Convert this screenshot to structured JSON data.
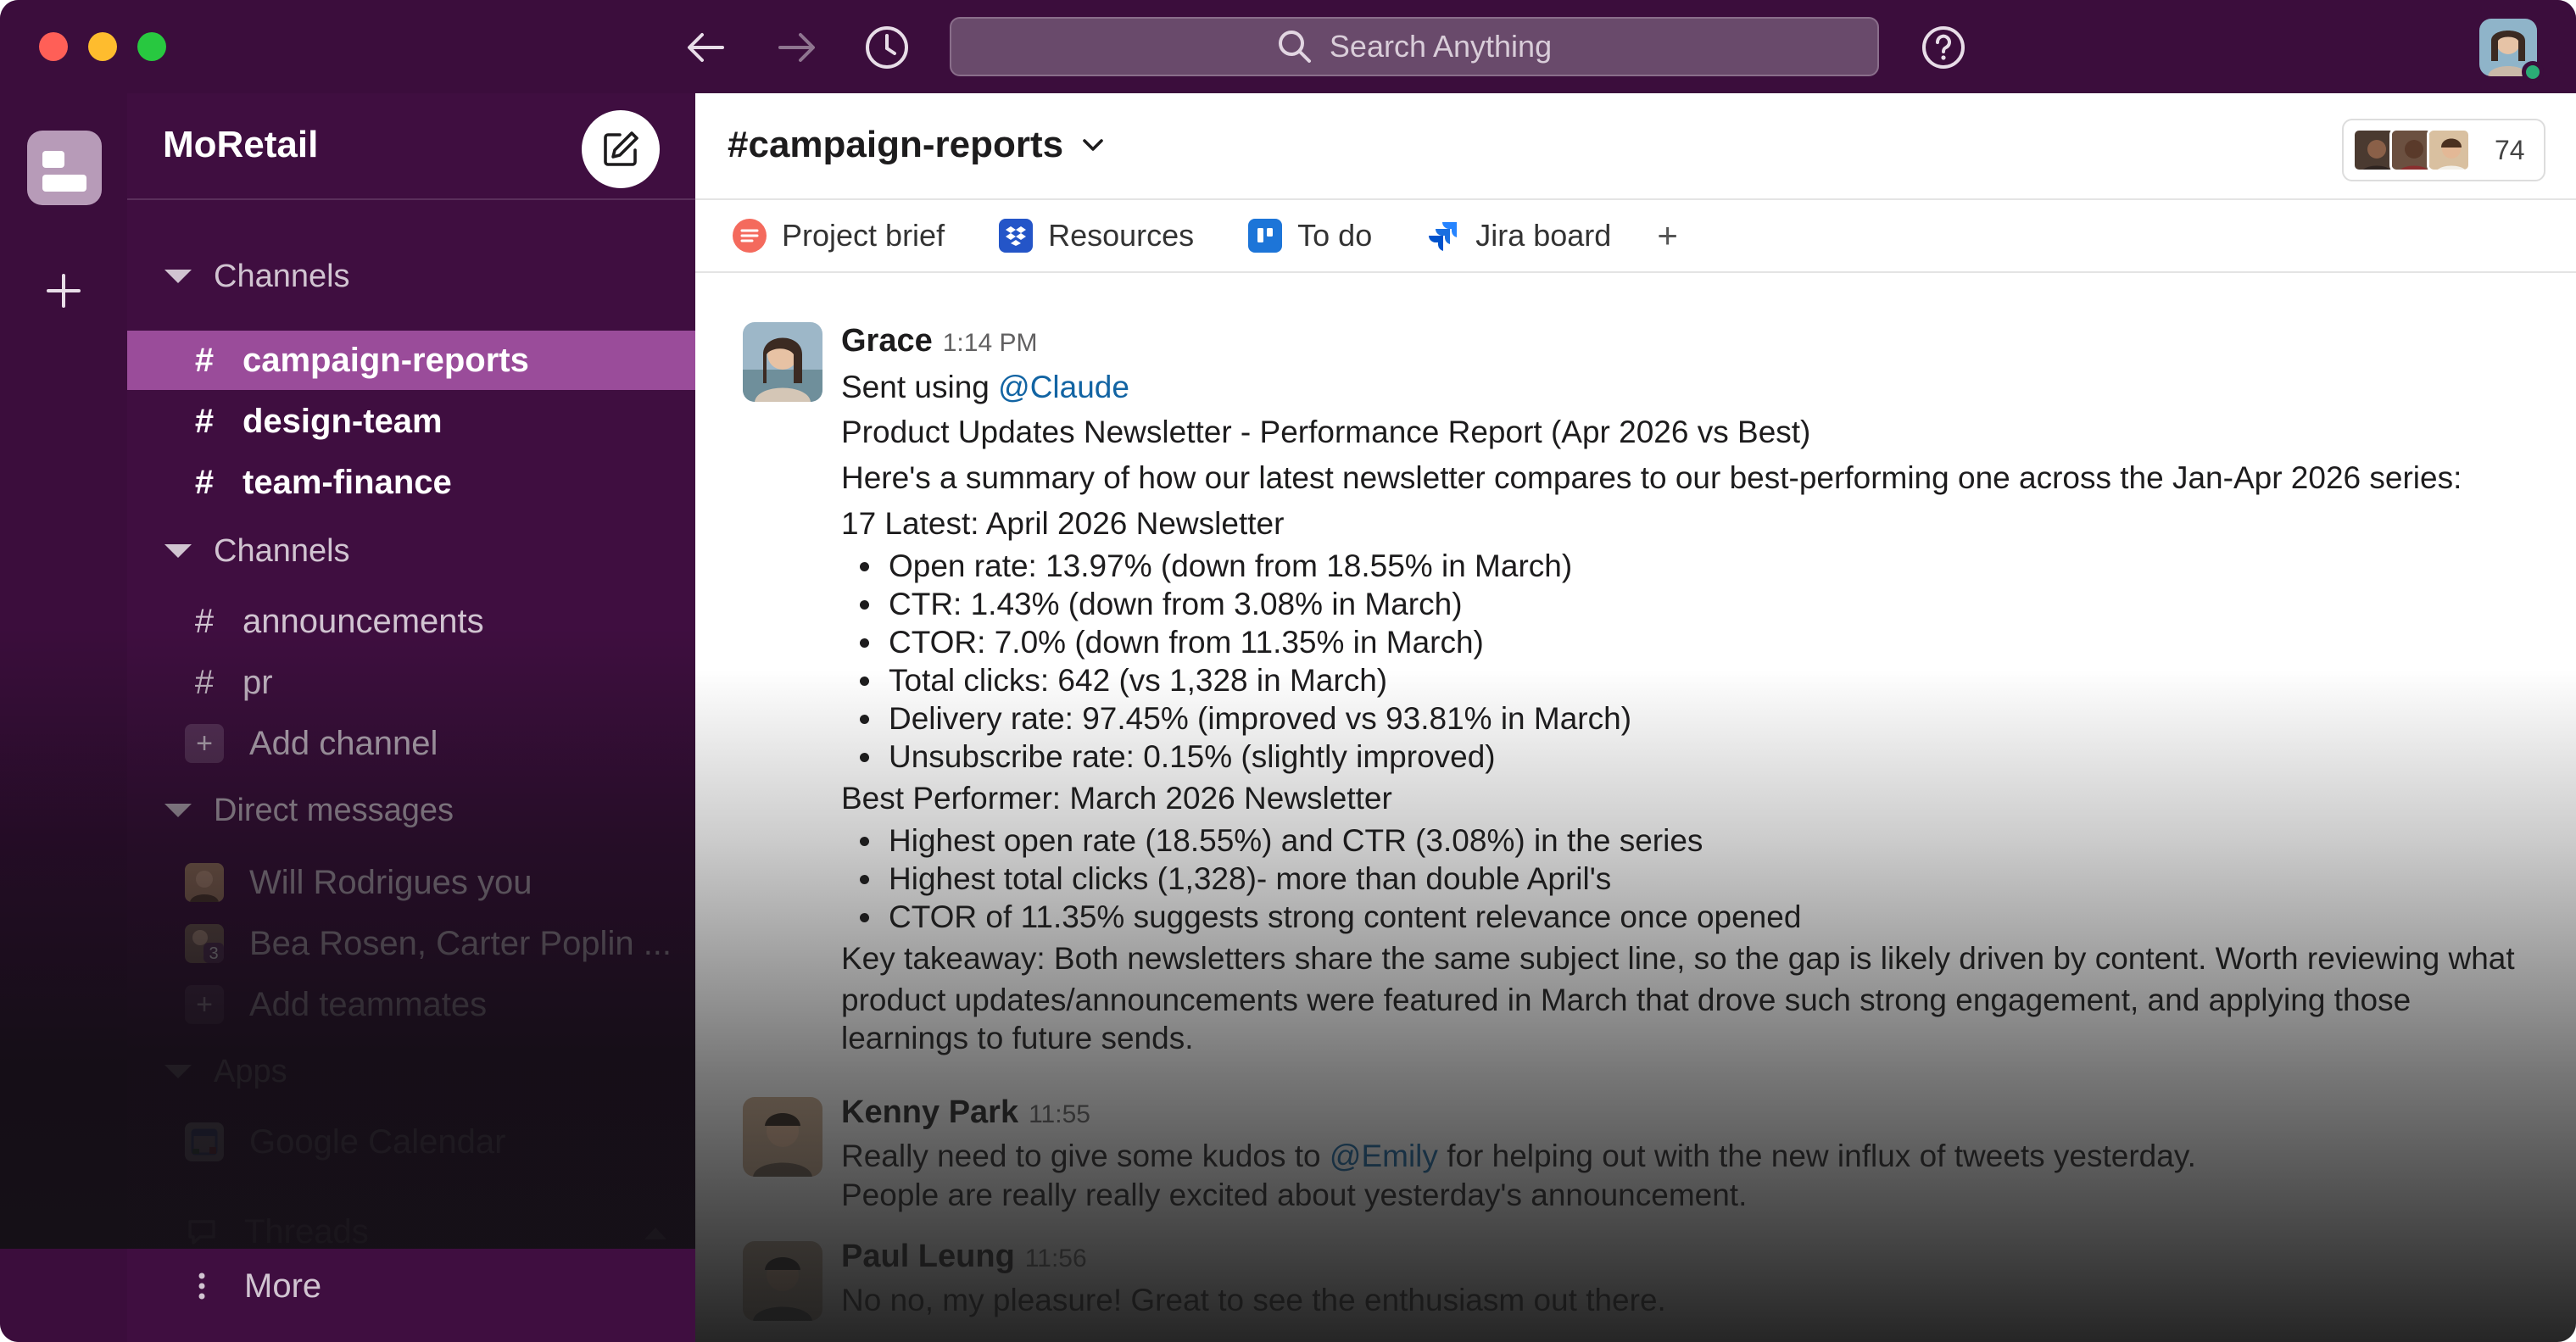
{
  "search": {
    "placeholder": "Search Anything"
  },
  "workspace": {
    "name": "MoRetail"
  },
  "sidebar": {
    "sections": [
      {
        "label": "Channels"
      },
      {
        "label": "Channels"
      },
      {
        "label": "Direct messages"
      },
      {
        "label": "Apps"
      }
    ],
    "starred_channels": [
      "campaign-reports",
      "design-team",
      "team-finance"
    ],
    "channels": [
      "announcements",
      "pr"
    ],
    "add_channel": "Add channel",
    "dms": [
      {
        "label": "Will Rodrigues  you"
      },
      {
        "label": "Bea Rosen, Carter Poplin ...",
        "badge": "3"
      }
    ],
    "add_teammates": "Add teammates",
    "apps": [
      "Google Calendar"
    ],
    "threads": "Threads",
    "more": "More"
  },
  "channel": {
    "title": "#campaign-reports",
    "member_count": "74",
    "bookmarks": [
      "Project brief",
      "Resources",
      "To do",
      "Jira board"
    ]
  },
  "messages": [
    {
      "user": "Grace",
      "time": "1:14 PM",
      "sent_using": "Sent using",
      "sent_mention": "@Claude",
      "line1": "Product Updates Newsletter - Performance Report (Apr 2026 vs Best)",
      "line2": "Here's a summary of how our latest newsletter compares to our best-performing one across the Jan-Apr 2026 series:",
      "latest_heading": "17 Latest: April 2026 Newsletter",
      "latest_items": [
        "Open rate: 13.97% (down from 18.55% in March)",
        "CTR: 1.43% (down from 3.08% in March)",
        "CTOR: 7.0% (down from 11.35% in March)",
        "Total clicks: 642 (vs 1,328 in March)",
        "Delivery rate: 97.45% (improved vs 93.81% in March)",
        "Unsubscribe rate: 0.15% (slightly improved)"
      ],
      "best_heading": "Best Performer: March 2026 Newsletter",
      "best_items": [
        "Highest open rate (18.55%) and CTR (3.08%) in the series",
        "Highest total clicks (1,328)- more than double April's",
        "CTOR of 11.35% suggests strong content relevance once opened"
      ],
      "takeaway_line1": "Key takeaway: Both newsletters share the same subject line, so the gap is likely driven by content. Worth reviewing what",
      "takeaway_line2": "product updates/announcements were featured in March that drove such strong engagement, and applying those",
      "takeaway_line3": "learnings to future sends."
    },
    {
      "user": "Kenny Park",
      "time": "11:55",
      "pre": "Really need to give some kudos to",
      "mention": "@Emily",
      "post": "for helping out with the new influx of tweets yesterday.",
      "line2": "People are really really excited about yesterday's announcement."
    },
    {
      "user": "Paul Leung",
      "time": "11:56",
      "text": "No no, my pleasure! Great to see the enthusiasm out there."
    }
  ],
  "colors": {
    "sidebar": "#3f0e40",
    "active_channel": "#9a4c9a",
    "mention": "#1264a3",
    "online": "#2bac76"
  }
}
